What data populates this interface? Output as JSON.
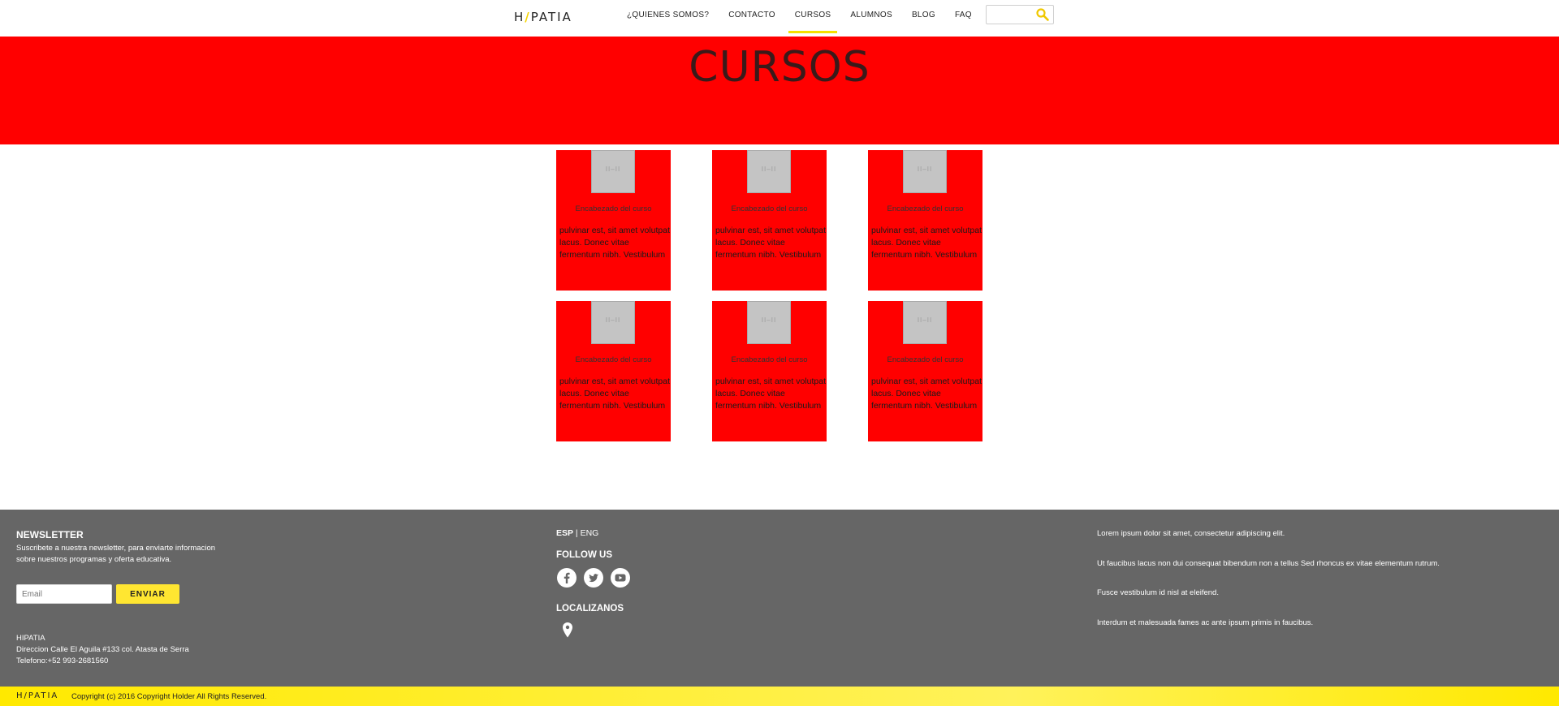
{
  "nav": {
    "logo": {
      "prefix": "H",
      "mark": "/",
      "suffix": "PATIA"
    },
    "items": [
      {
        "label": "¿QUIENES SOMOS?",
        "active": false
      },
      {
        "label": "CONTACTO",
        "active": false
      },
      {
        "label": "CURSOS",
        "active": true
      },
      {
        "label": "ALUMNOS",
        "active": false
      },
      {
        "label": "BLOG",
        "active": false
      },
      {
        "label": "FAQ",
        "active": false
      }
    ],
    "search": {
      "placeholder": "",
      "icon": "search-icon"
    }
  },
  "hero": {
    "title": "CURSOS"
  },
  "cards": [
    {
      "image_placeholder": "II–II",
      "title": "Encabezado del curso",
      "text": "pulvinar est, sit amet volutpat lacus. Donec vitae fermentum nibh. Vestibulum"
    },
    {
      "image_placeholder": "II–II",
      "title": "Encabezado del curso",
      "text": "pulvinar est, sit amet volutpat lacus. Donec vitae fermentum nibh. Vestibulum"
    },
    {
      "image_placeholder": "II–II",
      "title": "Encabezado del curso",
      "text": "pulvinar est, sit amet volutpat lacus. Donec vitae fermentum nibh. Vestibulum"
    },
    {
      "image_placeholder": "II–II",
      "title": "Encabezado del curso",
      "text": "pulvinar est, sit amet volutpat lacus. Donec vitae fermentum nibh. Vestibulum"
    },
    {
      "image_placeholder": "II–II",
      "title": "Encabezado del curso",
      "text": "pulvinar est, sit amet volutpat lacus. Donec vitae fermentum nibh. Vestibulum"
    },
    {
      "image_placeholder": "II–II",
      "title": "Encabezado del curso",
      "text": "pulvinar est, sit amet volutpat lacus. Donec vitae fermentum nibh. Vestibulum"
    }
  ],
  "footer": {
    "newsletter": {
      "title": "NEWSLETTER",
      "description": "Suscribete a nuestra newsletter, para enviarte informacion sobre nuestros programas y oferta educativa.",
      "email_placeholder": "Email",
      "button": "ENVIAR"
    },
    "address": {
      "name": "HIPATIA",
      "line": "Direccion Calle El Aguila #133 col. Atasta de Serra",
      "phone": "Telefono:+52 993-2681560"
    },
    "language": {
      "esp": "ESP",
      "separator": " | ",
      "eng": "ENG"
    },
    "follow_title": "FOLLOW US",
    "social": [
      "facebook-icon",
      "twitter-icon",
      "youtube-icon"
    ],
    "locate_title": "LOCALIZANOS",
    "lorem": [
      "Lorem ipsum dolor sit amet, consectetur adipiscing elit.",
      "Ut faucibus lacus non dui consequat bibendum non a tellus Sed rhoncus ex vitae elementum rutrum.",
      "Fusce vestibulum id nisl at eleifend.",
      "Interdum et malesuada fames ac ante ipsum primis in faucibus."
    ]
  },
  "bottombar": {
    "logo": "H/PATIA",
    "copyright": "Copyright (c) 2016 Copyright Holder All Rights Reserved."
  },
  "colors": {
    "accent_yellow": "#ffe631",
    "hero_red": "#ff0000",
    "footer_gray": "#666666"
  }
}
